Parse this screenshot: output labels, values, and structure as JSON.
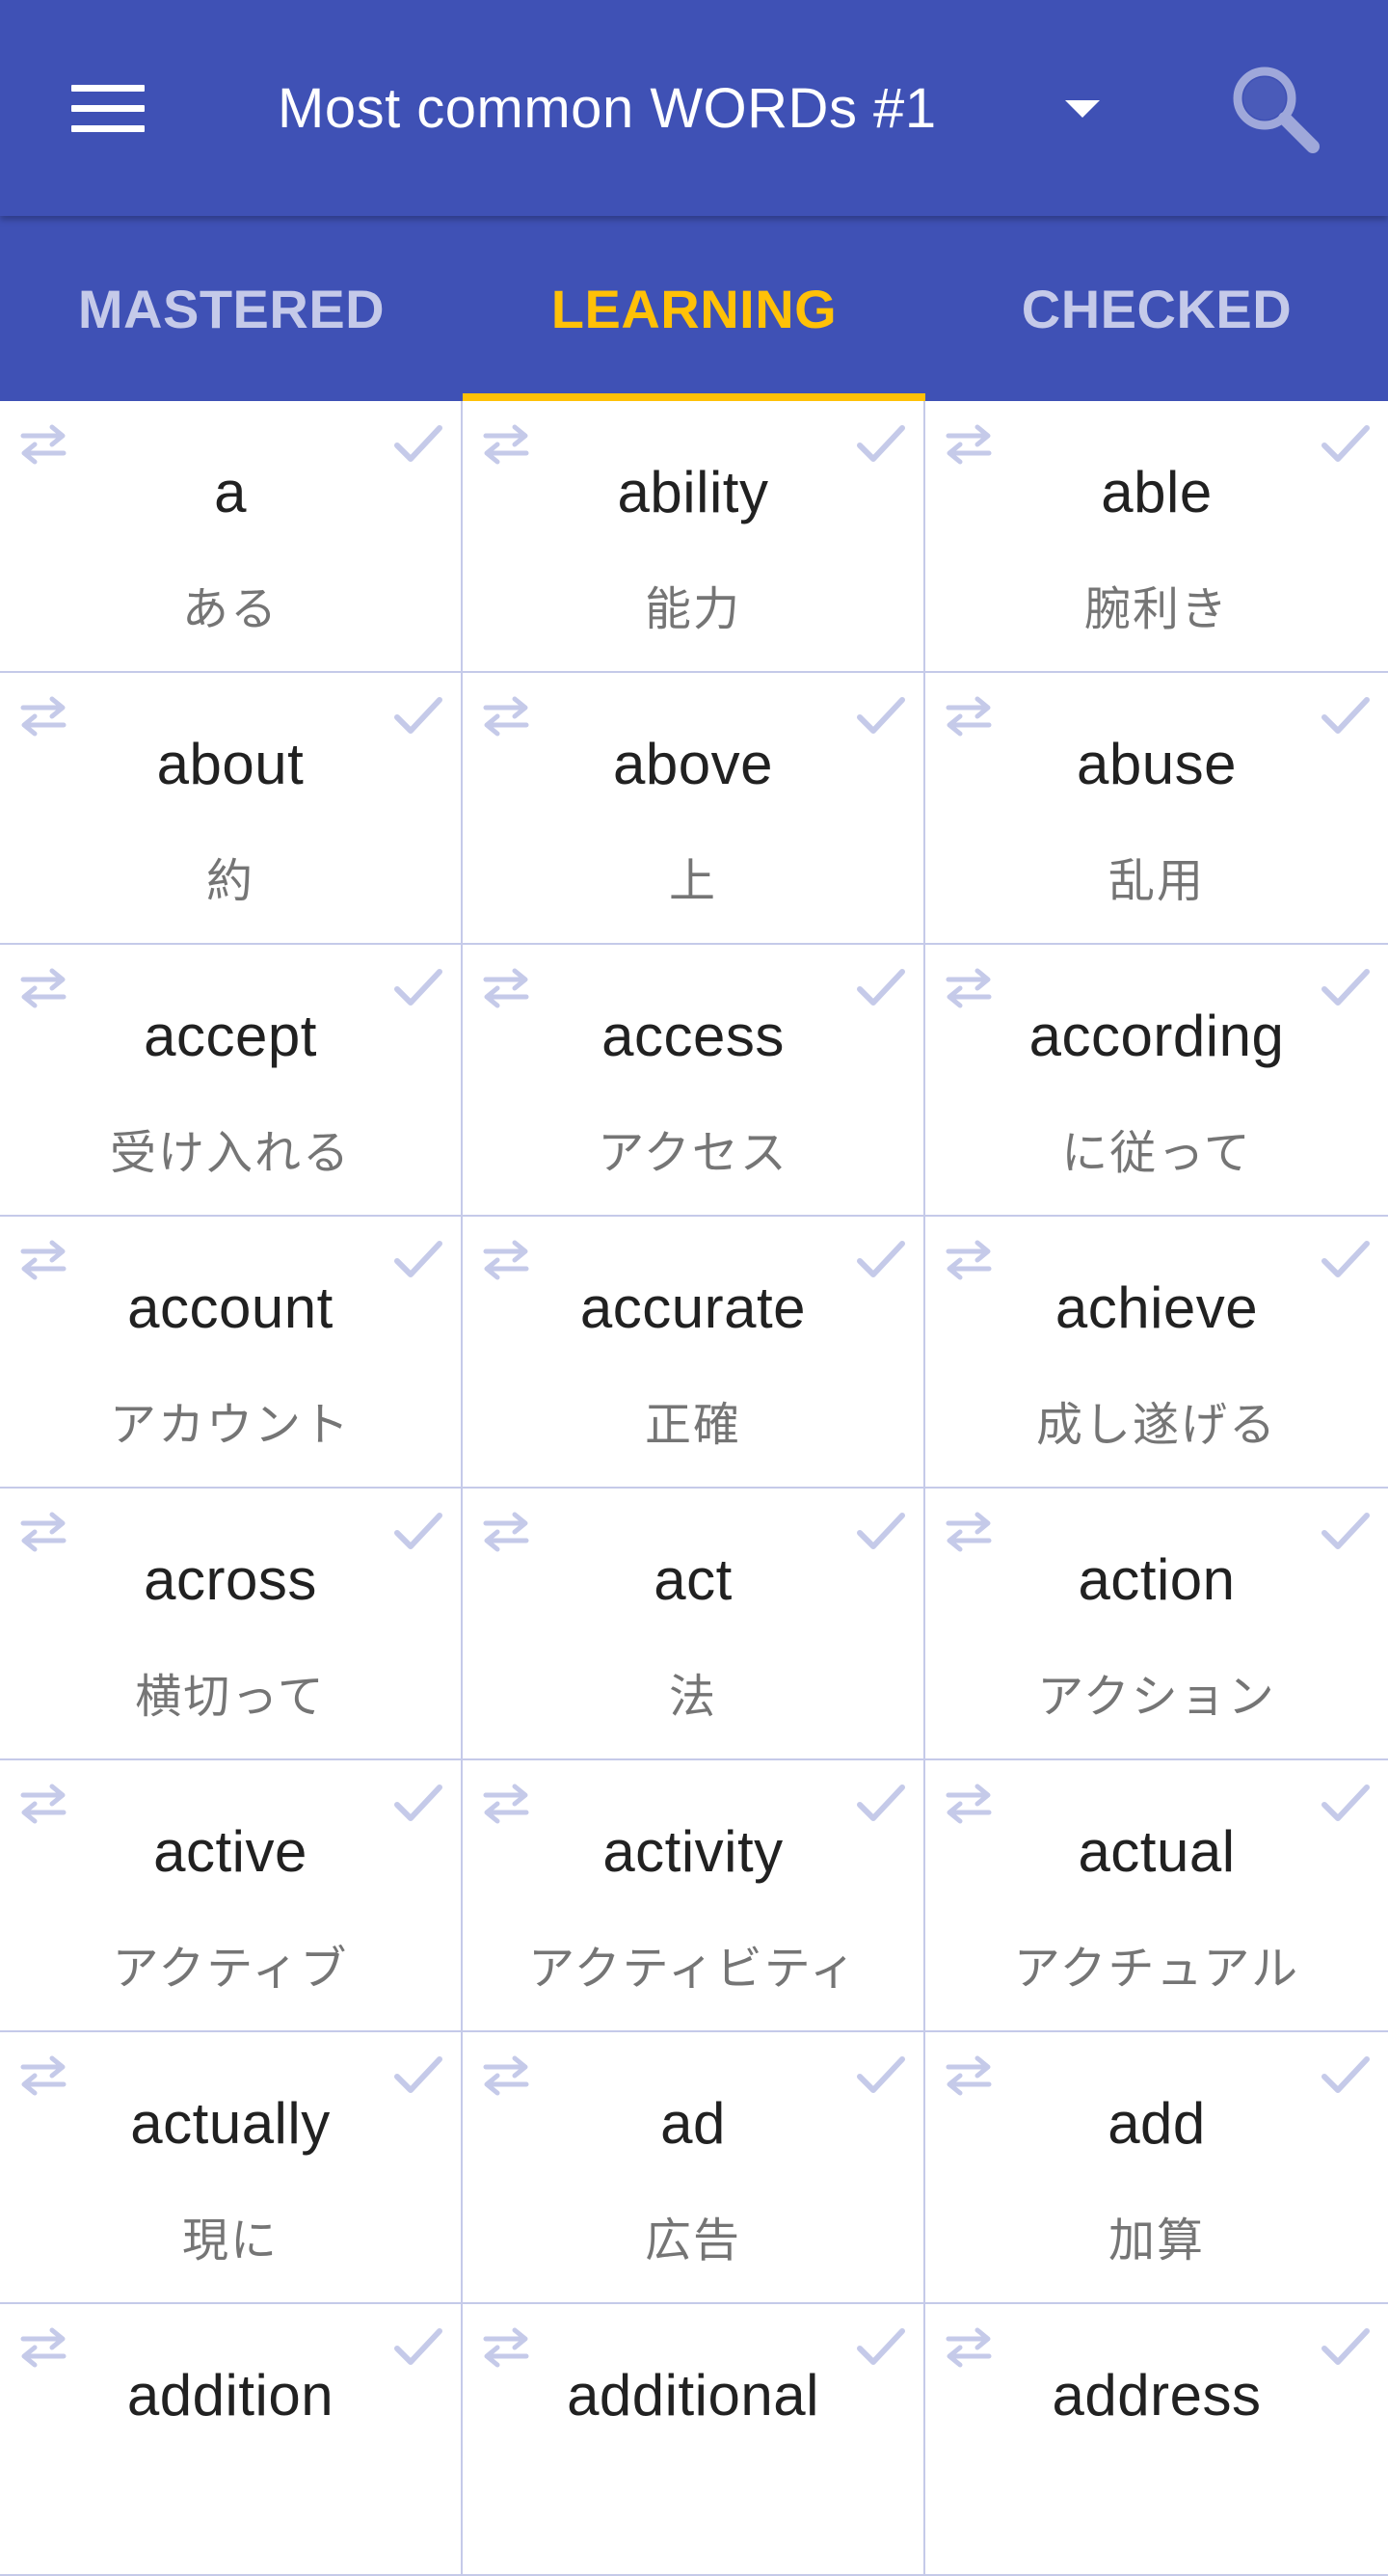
{
  "app_bar": {
    "title": "Most common WORDs #1",
    "menu_icon": "hamburger-menu-icon",
    "dropdown_icon": "dropdown-arrow-icon",
    "search_icon": "search-icon",
    "color": "#3f51b5"
  },
  "tabs": [
    {
      "label": "MASTERED",
      "active": false
    },
    {
      "label": "LEARNING",
      "active": true
    },
    {
      "label": "CHECKED",
      "active": false
    }
  ],
  "colors": {
    "accent": "#ffc107",
    "tab_inactive": "#c5cae9",
    "divider": "#c5cae9",
    "icon": "#c5cae9"
  },
  "words": [
    {
      "word": "a",
      "translation": "ある"
    },
    {
      "word": "ability",
      "translation": "能力"
    },
    {
      "word": "able",
      "translation": "腕利き"
    },
    {
      "word": "about",
      "translation": "約"
    },
    {
      "word": "above",
      "translation": "上"
    },
    {
      "word": "abuse",
      "translation": "乱用"
    },
    {
      "word": "accept",
      "translation": "受け入れる"
    },
    {
      "word": "access",
      "translation": "アクセス"
    },
    {
      "word": "according",
      "translation": "に従って"
    },
    {
      "word": "account",
      "translation": "アカウント"
    },
    {
      "word": "accurate",
      "translation": "正確"
    },
    {
      "word": "achieve",
      "translation": "成し遂げる"
    },
    {
      "word": "across",
      "translation": "横切って"
    },
    {
      "word": "act",
      "translation": "法"
    },
    {
      "word": "action",
      "translation": "アクション"
    },
    {
      "word": "active",
      "translation": "アクティブ"
    },
    {
      "word": "activity",
      "translation": "アクティビティ"
    },
    {
      "word": "actual",
      "translation": "アクチュアル"
    },
    {
      "word": "actually",
      "translation": "現に"
    },
    {
      "word": "ad",
      "translation": "広告"
    },
    {
      "word": "add",
      "translation": "加算"
    },
    {
      "word": "addition",
      "translation": ""
    },
    {
      "word": "additional",
      "translation": ""
    },
    {
      "word": "address",
      "translation": ""
    }
  ],
  "cell_icons": {
    "left": "swap-arrows-icon",
    "right": "checkmark-icon"
  }
}
